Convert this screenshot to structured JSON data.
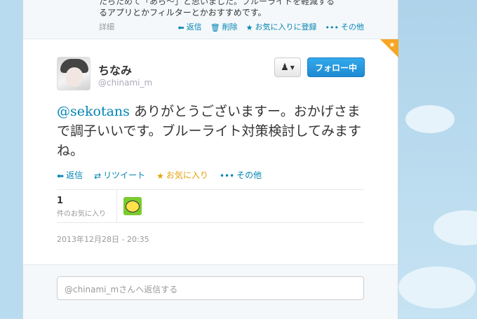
{
  "prev_tweet": {
    "text_line1": "たらためて「あら～」と思いました。ブルーライトを軽減する",
    "text_line2": "るアプリとかフィルターとかおすすめです。",
    "detail": "詳細",
    "actions": {
      "reply": "返信",
      "delete": "削除",
      "favorite": "お気に入りに登録",
      "more": "その他"
    }
  },
  "tweet": {
    "name": "ちなみ",
    "handle": "@chinami_m",
    "follow_button": "フォロー中",
    "mention": "@sekotans",
    "body": " ありがとうございますー。おかげさまで調子いいです。ブルーライト対策検討してみますね。",
    "actions": {
      "reply": "返信",
      "retweet": "リツイート",
      "favorite": "お気に入り",
      "more": "その他"
    },
    "favorites_count": "1",
    "favorites_label": "件のお気に入り",
    "timestamp": "2013年12月28日 - 20:35"
  },
  "reply": {
    "placeholder": "@chinami_mさんへ返信する"
  },
  "colors": {
    "link": "#0084b4",
    "fav": "#e4a10a",
    "follow_btn": "#1e8ad1"
  }
}
